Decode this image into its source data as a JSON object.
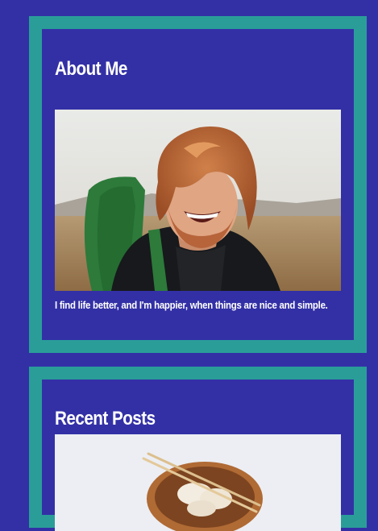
{
  "about": {
    "title": "About Me",
    "image_alt": "Smiling red-haired man with a green backpack outdoors",
    "text": "I find life better, and I'm happier, when things are nice and simple."
  },
  "recent_posts": {
    "title": "Recent Posts",
    "image_alt": "Wooden bowl of dumplings with chopsticks"
  },
  "colors": {
    "page_background": "#3330a6",
    "widget_border": "#2a9d99",
    "text": "#ffffff"
  }
}
